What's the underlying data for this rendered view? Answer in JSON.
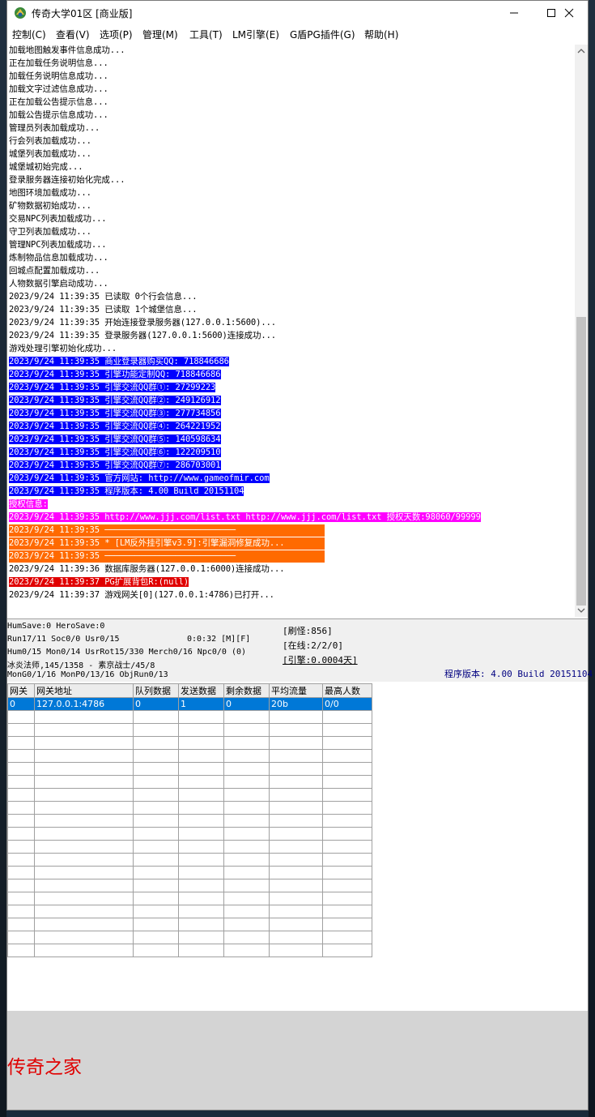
{
  "window": {
    "title": "传奇大学01区 [商业版]"
  },
  "menu": [
    "控制(C)",
    "查看(V)",
    "选项(P)",
    "管理(M)",
    "工具(T)",
    "LM引擎(E)",
    "G盾PG插件(G)",
    "帮助(H)"
  ],
  "log": [
    {
      "text": "加载地图触发事件信息成功...",
      "style": ""
    },
    {
      "text": "正在加载任务说明信息...",
      "style": ""
    },
    {
      "text": "加载任务说明信息成功...",
      "style": ""
    },
    {
      "text": "加载文字过滤信息成功...",
      "style": ""
    },
    {
      "text": "正在加载公告提示信息...",
      "style": ""
    },
    {
      "text": "加载公告提示信息成功...",
      "style": ""
    },
    {
      "text": "管理员列表加载成功...",
      "style": ""
    },
    {
      "text": "行会列表加载成功...",
      "style": ""
    },
    {
      "text": "城堡列表加载成功...",
      "style": ""
    },
    {
      "text": "城堡城初始完成...",
      "style": ""
    },
    {
      "text": "登录服务器连接初始化完成...",
      "style": ""
    },
    {
      "text": "地图环境加载成功...",
      "style": ""
    },
    {
      "text": "矿物数据初始成功...",
      "style": ""
    },
    {
      "text": "交易NPC列表加载成功...",
      "style": ""
    },
    {
      "text": "守卫列表加载成功...",
      "style": ""
    },
    {
      "text": "管理NPC列表加载成功...",
      "style": ""
    },
    {
      "text": "炼制物品信息加载成功...",
      "style": ""
    },
    {
      "text": "回城点配置加载成功...",
      "style": ""
    },
    {
      "text": "人物数据引擎启动成功...",
      "style": ""
    },
    {
      "text": "2023/9/24 11:39:35 已读取 0个行会信息...",
      "style": ""
    },
    {
      "text": "2023/9/24 11:39:35 已读取 1个城堡信息...",
      "style": ""
    },
    {
      "text": "2023/9/24 11:39:35 开始连接登录服务器(127.0.0.1:5600)...",
      "style": ""
    },
    {
      "text": "2023/9/24 11:39:35 登录服务器(127.0.0.1:5600)连接成功...",
      "style": ""
    },
    {
      "text": "游戏处理引擎初始化成功...",
      "style": ""
    },
    {
      "text": "2023/9/24 11:39:35 商业登录器购买QQ: 718846686",
      "style": "blue"
    },
    {
      "text": "2023/9/24 11:39:35 引擎功能定制QQ: 718846686",
      "style": "blue"
    },
    {
      "text": "2023/9/24 11:39:35 引擎交流QQ群①: 27299223",
      "style": "blue"
    },
    {
      "text": "2023/9/24 11:39:35 引擎交流QQ群②: 249126912",
      "style": "blue"
    },
    {
      "text": "2023/9/24 11:39:35 引擎交流QQ群③: 277734856",
      "style": "blue"
    },
    {
      "text": "2023/9/24 11:39:35 引擎交流QQ群④: 264221952",
      "style": "blue"
    },
    {
      "text": "2023/9/24 11:39:35 引擎交流QQ群⑤: 140598634",
      "style": "blue"
    },
    {
      "text": "2023/9/24 11:39:35 引擎交流QQ群⑥: 122209510",
      "style": "blue"
    },
    {
      "text": "2023/9/24 11:39:35 引擎交流QQ群⑦: 286703001",
      "style": "blue"
    },
    {
      "text": "2023/9/24 11:39:35 官方网站: http://www.gameofmir.com",
      "style": "blue"
    },
    {
      "text": "2023/9/24 11:39:35 程序版本: 4.00 Build 20151104",
      "style": "blue"
    },
    {
      "text": "授权信息:",
      "style": "magenta"
    },
    {
      "text": "2023/9/24 11:39:35 http://www.jjj.com/list.txt http://www.jjj.com/list.txt 授权天数:98060/99999",
      "style": "magenta"
    },
    {
      "text": "2023/9/24 11:39:35 ──────────────────────────",
      "style": "orange"
    },
    {
      "text": "2023/9/24 11:39:35 * [LM反外挂引擎v3.9]:引擎漏洞修复成功...",
      "style": "orange"
    },
    {
      "text": "2023/9/24 11:39:35 ──────────────────────────",
      "style": "orange"
    },
    {
      "text": "2023/9/24 11:39:36 数据库服务器(127.0.0.1:6000)连接成功...",
      "style": ""
    },
    {
      "text": "2023/9/24 11:39:37 PG扩展背包R:(null)",
      "style": "red"
    },
    {
      "text": "2023/9/24 11:39:37 游戏网关[0](127.0.0.1:4786)已打开...",
      "style": ""
    }
  ],
  "status": {
    "humsave": "HumSave:0 HeroSave:0",
    "run": "Run17/11 Soc0/0 Usr0/15",
    "time": "0:0:32 [M][F]",
    "hum": "Hum0/15 Mon0/14 UsrRot15/330 Merch0/16 Npc0/0 (0)",
    "player": "冰炎法师,145/1358 - 素京战士/45/8",
    "mon": "MonG0/1/16 MonP0/13/16 ObjRun0/13",
    "refresh": "[刷怪:856]",
    "online": "[在线:2/2/0]",
    "engine": "[引擎:0.0004天]",
    "version": "程序版本: 4.00 Build 20151104"
  },
  "grid": {
    "headers": [
      "网关",
      "网关地址",
      "队列数据",
      "发送数据",
      "剩余数据",
      "平均流量",
      "最高人数"
    ],
    "rows": [
      [
        "0",
        "127.0.0.1:4786",
        "0",
        "1",
        "0",
        "20b",
        "0/0"
      ]
    ],
    "empty_rows": 19
  },
  "watermark": "传奇之家",
  "colors": {
    "blue_highlight": "#0000ff",
    "magenta_highlight": "#ff00ff",
    "orange_highlight": "#ff6a00",
    "red_highlight": "#e00000",
    "selection": "#0078d7",
    "version_text": "#000080"
  }
}
